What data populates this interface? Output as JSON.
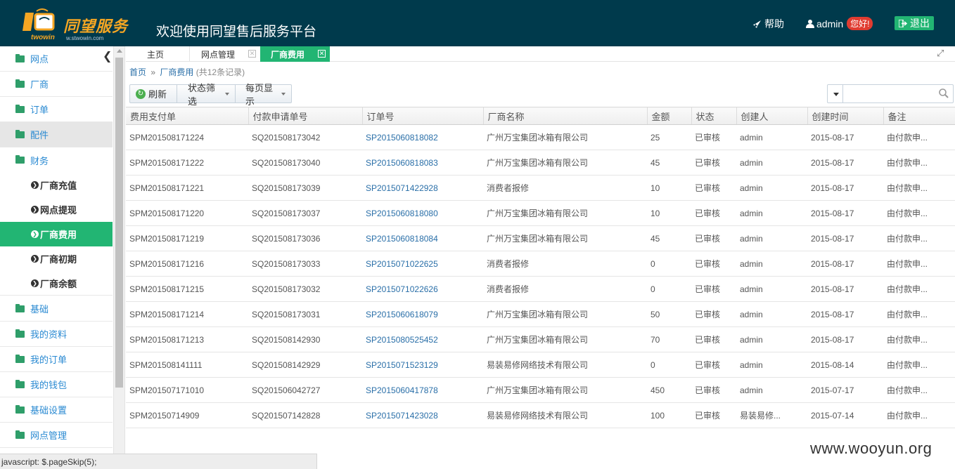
{
  "header": {
    "logo_text": "同望服务",
    "logo_sub": "twowin",
    "logo_url": "w.stwowin.com",
    "site_title": "欢迎使用同望售后服务平台",
    "help_label": "帮助",
    "user_name": "admin",
    "greeting_badge": "您好!",
    "logout_label": "退出"
  },
  "sidebar": {
    "items": [
      {
        "label": "网点"
      },
      {
        "label": "厂商"
      },
      {
        "label": "订单"
      },
      {
        "label": "配件"
      },
      {
        "label": "财务"
      },
      {
        "label": "基础"
      },
      {
        "label": "我的资料"
      },
      {
        "label": "我的订单"
      },
      {
        "label": "我的钱包"
      },
      {
        "label": "基础设置"
      },
      {
        "label": "网点管理"
      }
    ],
    "finance_sub": [
      {
        "label": "厂商充值"
      },
      {
        "label": "网点提现"
      },
      {
        "label": "厂商费用"
      },
      {
        "label": "厂商初期"
      },
      {
        "label": "厂商余额"
      }
    ]
  },
  "tabs": [
    {
      "label": "主页"
    },
    {
      "label": "网点管理"
    },
    {
      "label": "厂商费用"
    }
  ],
  "breadcrumb": {
    "home": "首页",
    "sep": "»",
    "current": "厂商费用",
    "count": "(共12条记录)"
  },
  "toolbar": {
    "refresh": "刷新",
    "status_filter": "状态筛选",
    "page_size": "每页显示"
  },
  "search": {
    "placeholder": "",
    "value": ""
  },
  "table": {
    "columns": [
      "费用支付单",
      "付款申请单号",
      "订单号",
      "厂商名称",
      "金额",
      "状态",
      "创建人",
      "创建时间",
      "备注"
    ],
    "rows": [
      [
        "SPM201508171224",
        "SQ201508173042",
        "SP2015060818082",
        "广州万宝集团冰箱有限公司",
        "25",
        "已审核",
        "admin",
        "2015-08-17",
        "由付款申..."
      ],
      [
        "SPM201508171222",
        "SQ201508173040",
        "SP2015060818083",
        "广州万宝集团冰箱有限公司",
        "45",
        "已审核",
        "admin",
        "2015-08-17",
        "由付款申..."
      ],
      [
        "SPM201508171221",
        "SQ201508173039",
        "SP2015071422928",
        "消费者报修",
        "10",
        "已审核",
        "admin",
        "2015-08-17",
        "由付款申..."
      ],
      [
        "SPM201508171220",
        "SQ201508173037",
        "SP2015060818080",
        "广州万宝集团冰箱有限公司",
        "10",
        "已审核",
        "admin",
        "2015-08-17",
        "由付款申..."
      ],
      [
        "SPM201508171219",
        "SQ201508173036",
        "SP2015060818084",
        "广州万宝集团冰箱有限公司",
        "45",
        "已审核",
        "admin",
        "2015-08-17",
        "由付款申..."
      ],
      [
        "SPM201508171216",
        "SQ201508173033",
        "SP2015071022625",
        "消费者报修",
        "0",
        "已审核",
        "admin",
        "2015-08-17",
        "由付款申..."
      ],
      [
        "SPM201508171215",
        "SQ201508173032",
        "SP2015071022626",
        "消费者报修",
        "0",
        "已审核",
        "admin",
        "2015-08-17",
        "由付款申..."
      ],
      [
        "SPM201508171214",
        "SQ201508173031",
        "SP2015060618079",
        "广州万宝集团冰箱有限公司",
        "50",
        "已审核",
        "admin",
        "2015-08-17",
        "由付款申..."
      ],
      [
        "SPM201508171213",
        "SQ201508142930",
        "SP2015080525452",
        "广州万宝集团冰箱有限公司",
        "70",
        "已审核",
        "admin",
        "2015-08-17",
        "由付款申..."
      ],
      [
        "SPM201508141111",
        "SQ201508142929",
        "SP2015071523129",
        "易装易修网络技术有限公司",
        "0",
        "已审核",
        "admin",
        "2015-08-14",
        "由付款申..."
      ],
      [
        "SPM201507171010",
        "SQ201506042727",
        "SP2015060417878",
        "广州万宝集团冰箱有限公司",
        "450",
        "已审核",
        "admin",
        "2015-07-17",
        "由付款申..."
      ],
      [
        "SPM20150714909",
        "SQ201507142828",
        "SP2015071423028",
        "易装易修网络技术有限公司",
        "100",
        "已审核",
        "易装易修...",
        "2015-07-14",
        "由付款申..."
      ]
    ]
  },
  "statusbar": "javascript: $.pageSkip(5);",
  "watermark": "www.wooyun.org",
  "colors": {
    "header_bg": "#003a4c",
    "accent": "#22b573",
    "link": "#2a6fa8",
    "badge": "#e03c31"
  }
}
